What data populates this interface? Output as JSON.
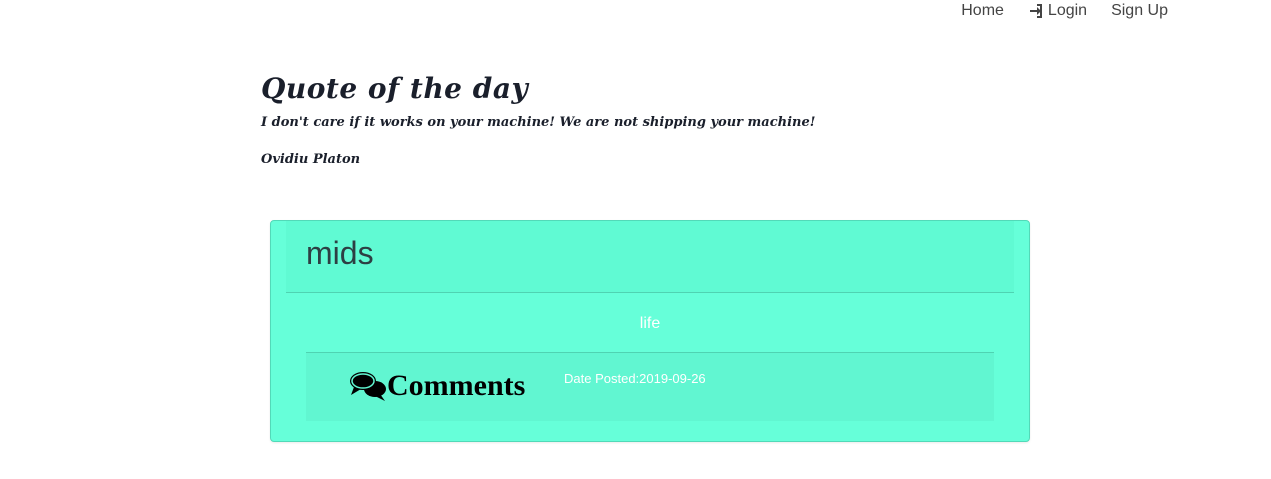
{
  "nav": {
    "home_label": "Home",
    "login_label": "Login",
    "signup_label": "Sign Up"
  },
  "quote": {
    "heading": "Quote of the day",
    "text": "I don't care if it works on your machine! We are not shipping your machine!",
    "author": "Ovidiu Platon"
  },
  "post": {
    "title": "mids",
    "category": "life",
    "comments_label": "Comments",
    "date_label": "Date Posted:",
    "date_value": "2019-09-26"
  },
  "colors": {
    "card_background": "#66ffd9",
    "text_dark": "#1a1f2b"
  }
}
